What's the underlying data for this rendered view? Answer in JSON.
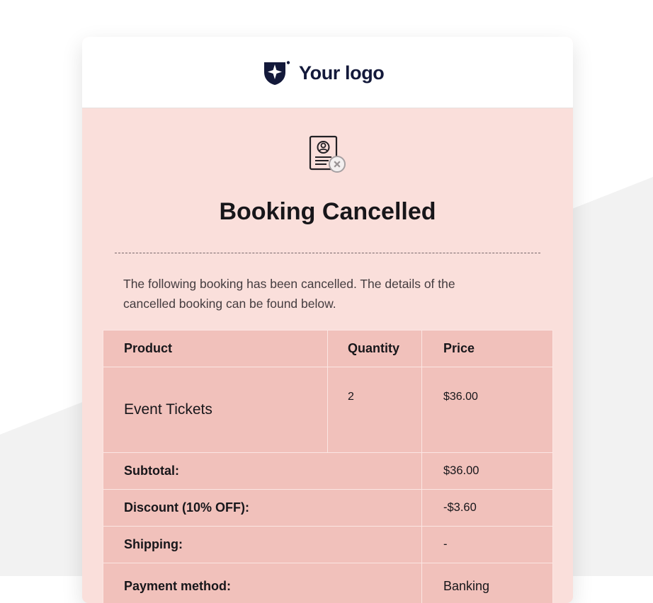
{
  "header": {
    "logo_text": "Your logo",
    "logo_icon": "shield-star-logo-icon"
  },
  "email": {
    "hero_icon": "cancelled-booking-document-icon",
    "title": "Booking Cancelled",
    "intro": "The following booking has been cancelled. The details of the cancelled booking can be found below."
  },
  "order_table": {
    "headers": {
      "product": "Product",
      "quantity": "Quantity",
      "price": "Price"
    },
    "items": [
      {
        "product": "Event Tickets",
        "quantity": "2",
        "price": "$36.00"
      }
    ],
    "summary": [
      {
        "label": "Subtotal:",
        "value": "$36.00"
      },
      {
        "label": "Discount (10% OFF):",
        "value": "-$3.60"
      },
      {
        "label": "Shipping:",
        "value": "-"
      },
      {
        "label": "Payment method:",
        "value": "Banking"
      }
    ]
  },
  "colors": {
    "page_background": "#ffffff",
    "wave_background": "#f2f2f2",
    "card_background": "#fadfdb",
    "table_background": "#f1c1bb",
    "title_text": "#17161a",
    "logo_navy": "#13193a"
  }
}
